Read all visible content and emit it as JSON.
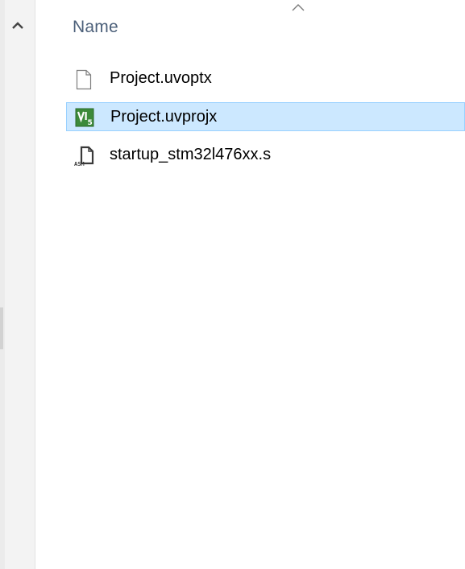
{
  "header": {
    "name_column_label": "Name",
    "sort_indicator_icon": "chevron-up-icon"
  },
  "nav_pane": {
    "scroll_up_icon": "chevron-up-icon"
  },
  "files": [
    {
      "name": "Project.uvoptx",
      "icon": "blank-file-icon",
      "selected": false
    },
    {
      "name": "Project.uvprojx",
      "icon": "keil-uvision-project-icon",
      "selected": true
    },
    {
      "name": "startup_stm32l476xx.s",
      "icon": "asm-file-icon",
      "selected": false
    }
  ],
  "colors": {
    "selection_bg": "#cce8ff",
    "selection_border": "#99d1ff",
    "header_text": "#4c607a",
    "keil_icon_green": "#3c8a3a"
  }
}
